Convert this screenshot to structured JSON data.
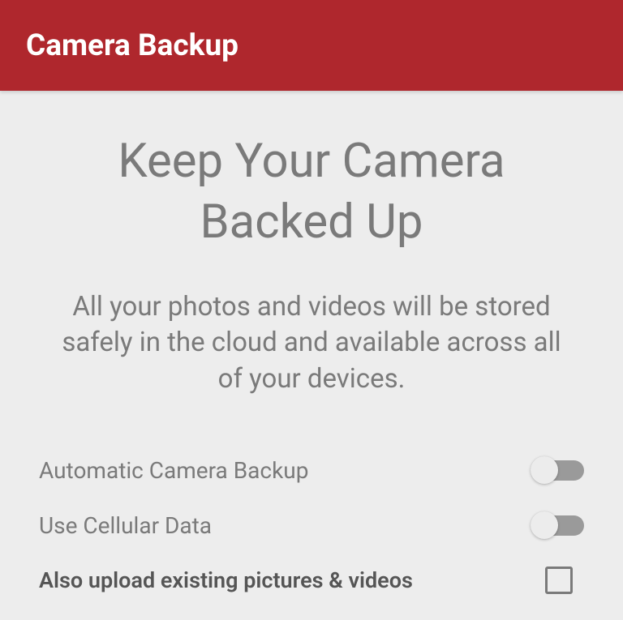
{
  "header": {
    "title": "Camera Backup"
  },
  "main": {
    "title": "Keep Your Camera Backed Up",
    "description": "All your photos and videos will be stored safely in the cloud and available across all of your devices."
  },
  "settings": {
    "auto_backup": {
      "label": "Automatic Camera Backup",
      "enabled": false
    },
    "cellular": {
      "label": "Use Cellular Data",
      "enabled": false
    },
    "upload_existing": {
      "label": "Also upload existing pictures & videos",
      "checked": false
    }
  }
}
